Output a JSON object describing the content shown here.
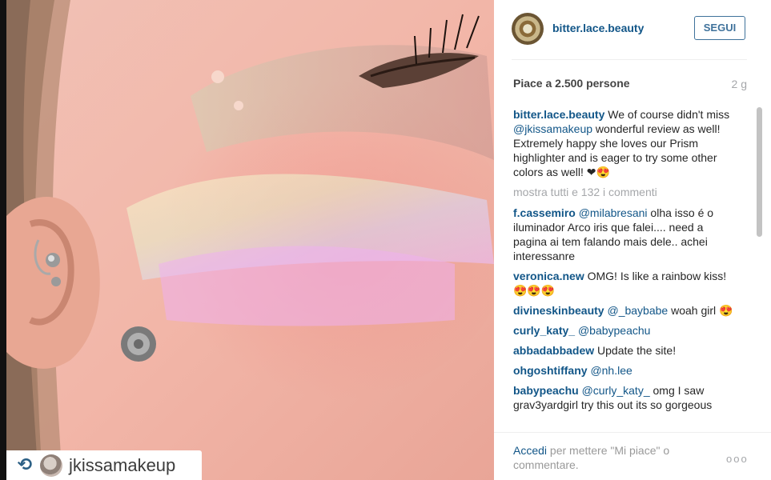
{
  "repost": {
    "username": "jkissamakeup",
    "icon": "repost-icon"
  },
  "post": {
    "username": "bitter.lace.beauty",
    "follow_label": "SEGUI",
    "likes": "Piace a 2.500 persone",
    "time": "2 g",
    "caption": {
      "user": "bitter.lace.beauty",
      "text_1": " We of course didn't miss ",
      "mention": "@jkissamakeup",
      "text_2": " wonderful review as well! Extremely happy she loves our Prism highlighter and is eager to try some other colors as well! ❤😍"
    },
    "load_more": "mostra tutti e 132 i commenti",
    "comments": [
      {
        "user": "f.cassemiro",
        "mention": "@milabresani",
        "text": " olha isso é o iluminador Arco iris que falei.... need a pagina ai tem falando mais dele.. achei interessanre"
      },
      {
        "user": "veronica.new",
        "mention": "",
        "text": " OMG! Is like a rainbow kiss! 😍😍😍"
      },
      {
        "user": "divineskinbeauty",
        "mention": "@_baybabe",
        "text": " woah girl 😍"
      },
      {
        "user": "curly_katy_",
        "mention": "@babypeachu",
        "text": ""
      },
      {
        "user": "abbadabbadew",
        "mention": "",
        "text": " Update the site!"
      },
      {
        "user": "ohgoshtiffany",
        "mention": "@nh.lee",
        "text": ""
      },
      {
        "user": "babypeachu",
        "mention": "@curly_katy_",
        "text": " omg I saw grav3yardgirl try this out its so gorgeous"
      }
    ]
  },
  "footer": {
    "login_link": "Accedi",
    "login_text": " per mettere \"Mi piace\" o commentare.",
    "more_label": "ooo"
  },
  "colors": {
    "link": "#125688",
    "follow_border": "#3f729b",
    "muted": "#a5a7aa"
  }
}
